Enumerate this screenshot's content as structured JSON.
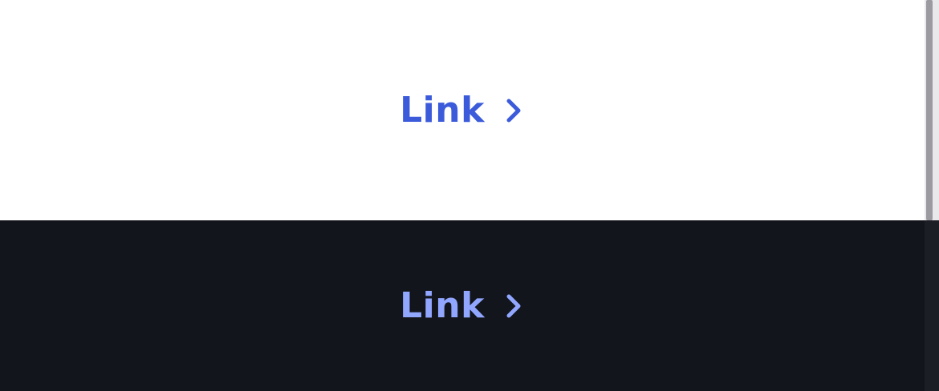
{
  "light_section": {
    "link_label": "Link",
    "link_color": "#3b5bdb",
    "background": "#ffffff",
    "icon": "chevron-right-icon"
  },
  "dark_section": {
    "link_label": "Link",
    "link_color": "#91a7ff",
    "background": "#13151d",
    "icon": "chevron-right-icon"
  }
}
